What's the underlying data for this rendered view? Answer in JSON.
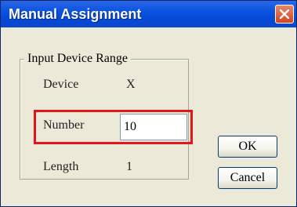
{
  "window": {
    "title": "Manual Assignment"
  },
  "group": {
    "legend": "Input Device Range",
    "device_label": "Device",
    "device_value": "X",
    "number_label": "Number",
    "number_value": "10",
    "length_label": "Length",
    "length_value": "1"
  },
  "buttons": {
    "ok": "OK",
    "cancel": "Cancel"
  },
  "colors": {
    "titlebar": "#0648d6",
    "highlight": "#e2161b",
    "dialog_bg": "#ece9d8"
  }
}
